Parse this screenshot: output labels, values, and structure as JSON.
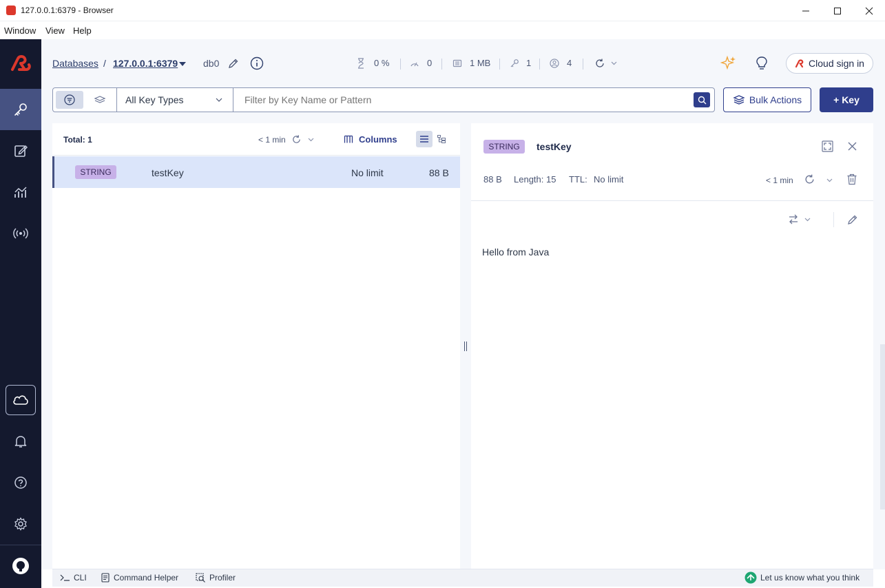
{
  "window": {
    "title": "127.0.0.1:6379 - Browser",
    "menu": [
      "Window",
      "View",
      "Help"
    ]
  },
  "header": {
    "breadcrumb_root": "Databases",
    "breadcrumb_sep": "/",
    "database": "127.0.0.1:6379",
    "db_index": "db0",
    "stats": {
      "cpu": "0 %",
      "ops": "0",
      "memory": "1 MB",
      "keys": "1",
      "clients": "4"
    },
    "cloud_sign_in": "Cloud sign in"
  },
  "filter": {
    "key_type": "All Key Types",
    "search_placeholder": "Filter by Key Name or Pattern",
    "bulk_actions": "Bulk Actions",
    "add_key": "+ Key"
  },
  "key_list": {
    "total": "Total: 1",
    "refresh_age": "< 1 min",
    "columns_label": "Columns",
    "rows": [
      {
        "type": "STRING",
        "name": "testKey",
        "ttl": "No limit",
        "size": "88 B"
      }
    ]
  },
  "key_detail": {
    "type": "STRING",
    "name": "testKey",
    "size": "88 B",
    "length": "Length: 15",
    "ttl_label": "TTL:",
    "ttl_value": "No limit",
    "refresh_age": "< 1 min",
    "value": "Hello from Java"
  },
  "bottom": {
    "cli": "CLI",
    "command_helper": "Command Helper",
    "profiler": "Profiler",
    "feedback": "Let us know what you think"
  },
  "colors": {
    "nav_bg": "#14192e",
    "nav_active": "#465282",
    "accent": "#2f3e8c",
    "string_badge": "#c7b1e8",
    "selected_row": "#dbe5fa",
    "brand_red": "#dc382c"
  }
}
